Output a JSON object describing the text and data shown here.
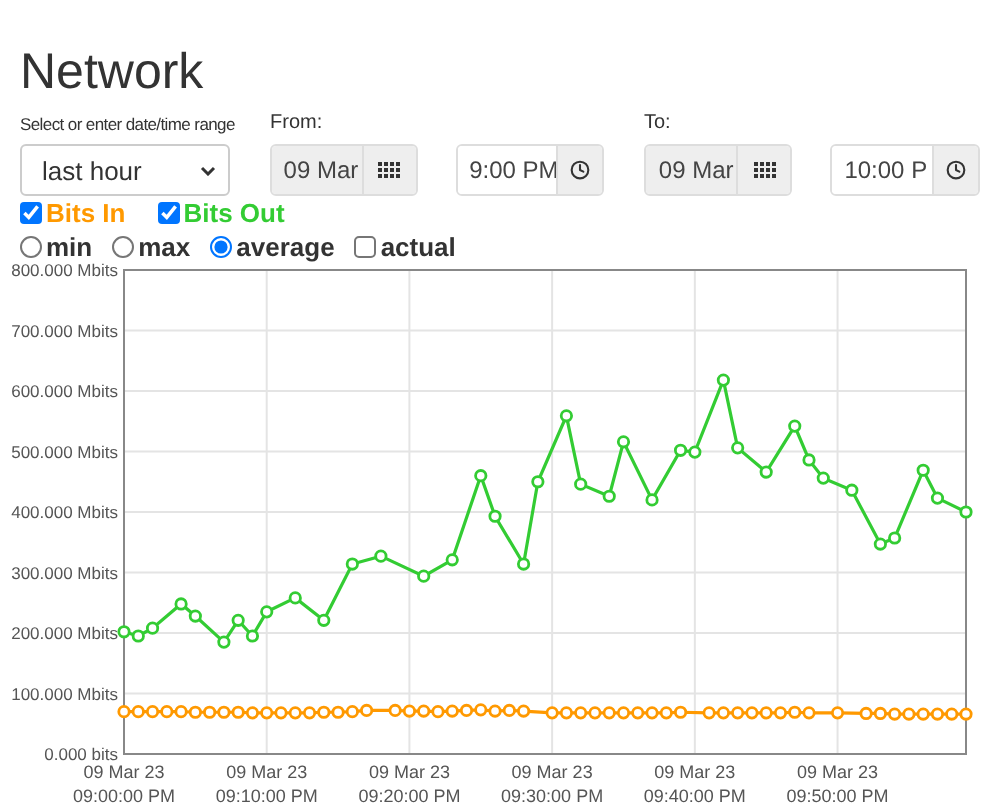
{
  "title": "Network",
  "range": {
    "label": "Select or enter date/time range",
    "value": "last hour"
  },
  "from": {
    "label": "From:",
    "date": "09 Mar",
    "time": "9:00 PM"
  },
  "to": {
    "label": "To:",
    "date": "09 Mar",
    "time": "10:00 P"
  },
  "series_toggles": [
    {
      "label": "Bits In",
      "checked": true,
      "color": "#ff9900"
    },
    {
      "label": "Bits Out",
      "checked": true,
      "color": "#33cc33"
    }
  ],
  "modes": [
    {
      "kind": "radio",
      "label": "min",
      "selected": false
    },
    {
      "kind": "radio",
      "label": "max",
      "selected": false
    },
    {
      "kind": "radio",
      "label": "average",
      "selected": true
    },
    {
      "kind": "checkbox",
      "label": "actual",
      "checked": false
    }
  ],
  "chart_data": {
    "type": "line",
    "grid": true,
    "ylim": [
      0,
      800
    ],
    "categories": [
      "09 Mar 23 09:00:00 PM",
      null,
      null,
      null,
      null,
      null,
      null,
      null,
      null,
      null,
      "09 Mar 23 09:10:00 PM",
      null,
      null,
      null,
      null,
      null,
      null,
      null,
      null,
      null,
      "09 Mar 23 09:20:00 PM",
      null,
      null,
      null,
      null,
      null,
      null,
      null,
      null,
      null,
      "09 Mar 23 09:30:00 PM",
      null,
      null,
      null,
      null,
      null,
      null,
      null,
      null,
      null,
      "09 Mar 23 09:40:00 PM",
      null,
      null,
      null,
      null,
      null,
      null,
      null,
      null,
      null,
      "09 Mar 23 09:50:00 PM",
      null,
      null,
      null,
      null,
      null,
      null,
      null,
      null,
      null
    ],
    "yticks": [
      {
        "value": 0,
        "label": "0.000 bits"
      },
      {
        "value": 100,
        "label": "100.000 Mbits"
      },
      {
        "value": 200,
        "label": "200.000 Mbits"
      },
      {
        "value": 300,
        "label": "300.000 Mbits"
      },
      {
        "value": 400,
        "label": "400.000 Mbits"
      },
      {
        "value": 500,
        "label": "500.000 Mbits"
      },
      {
        "value": 600,
        "label": "600.000 Mbits"
      },
      {
        "value": 700,
        "label": "700.000 Mbits"
      },
      {
        "value": 800,
        "label": "800.000 Mbits"
      }
    ],
    "series": [
      {
        "color": "#33cc33",
        "marker": "circle",
        "values": [
          202,
          195,
          208,
          null,
          248,
          228,
          null,
          185,
          221,
          195,
          235,
          null,
          258,
          null,
          221,
          null,
          314,
          null,
          327,
          null,
          null,
          294,
          null,
          321,
          null,
          460,
          393,
          null,
          314,
          450,
          null,
          559,
          446,
          null,
          426,
          516,
          null,
          420,
          null,
          502,
          499,
          null,
          618,
          506,
          null,
          466,
          null,
          542,
          486,
          456,
          null,
          436,
          null,
          347,
          357,
          null,
          469,
          423,
          null,
          400
        ]
      },
      {
        "color": "#ff9900",
        "marker": "circle",
        "values": [
          70,
          70,
          70,
          70,
          70,
          69,
          69,
          69,
          69,
          68,
          68,
          68,
          68,
          68,
          69,
          69,
          70,
          72,
          null,
          72,
          71,
          71,
          70,
          71,
          72,
          73,
          71,
          72,
          71,
          null,
          68,
          68,
          68,
          68,
          68,
          68,
          68,
          68,
          68,
          69,
          null,
          68,
          68,
          68,
          68,
          68,
          68,
          69,
          68,
          null,
          68,
          null,
          67,
          67,
          66,
          66,
          66,
          66,
          66,
          66
        ]
      }
    ]
  }
}
